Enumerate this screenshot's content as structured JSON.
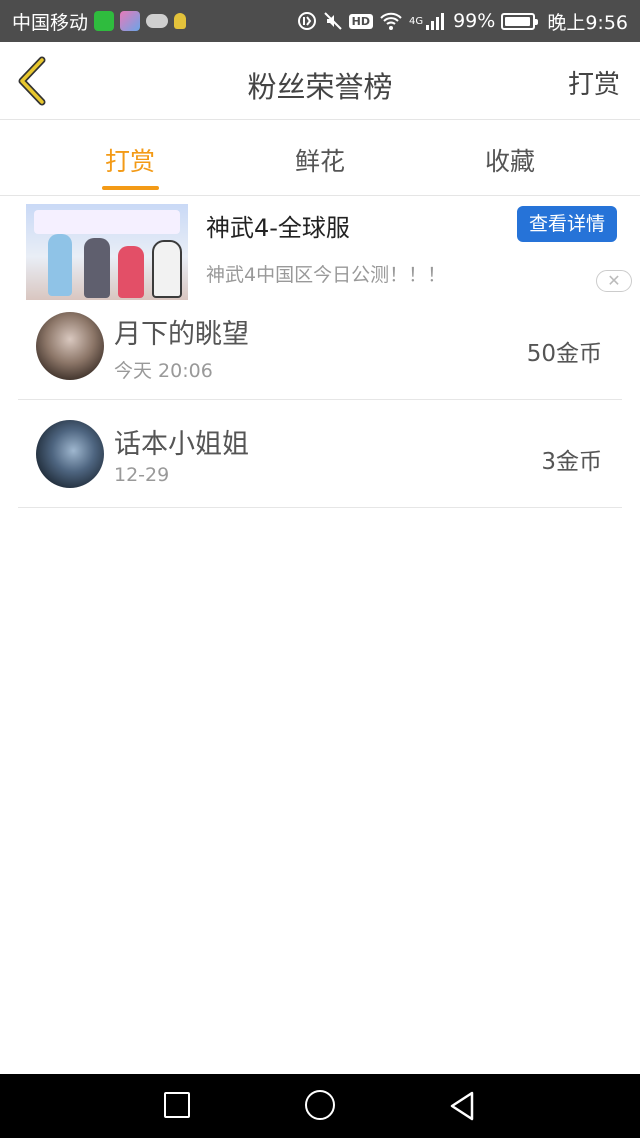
{
  "status_bar": {
    "carrier": "中国移动",
    "network": "4G",
    "battery": "99%",
    "time": "晚上9:56",
    "hd": "HD"
  },
  "header": {
    "title": "粉丝荣誉榜",
    "right_action": "打赏"
  },
  "tabs": [
    {
      "label": "打赏",
      "active": true
    },
    {
      "label": "鲜花",
      "active": false
    },
    {
      "label": "收藏",
      "active": false
    }
  ],
  "ad": {
    "title": "神武4-全球服",
    "subtitle": "神武4中国区今日公测！！！",
    "button_label": "查看详情",
    "close_label": "✕"
  },
  "leaderboard": [
    {
      "name": "月下的眺望",
      "time": "今天 20:06",
      "amount": "50金币"
    },
    {
      "name": "话本小姐姐",
      "time": "12-29",
      "amount": "3金币"
    }
  ],
  "colors": {
    "accent": "#f39a16",
    "status_bar_bg": "#4d4d4d",
    "ad_button": "#2673d8"
  }
}
